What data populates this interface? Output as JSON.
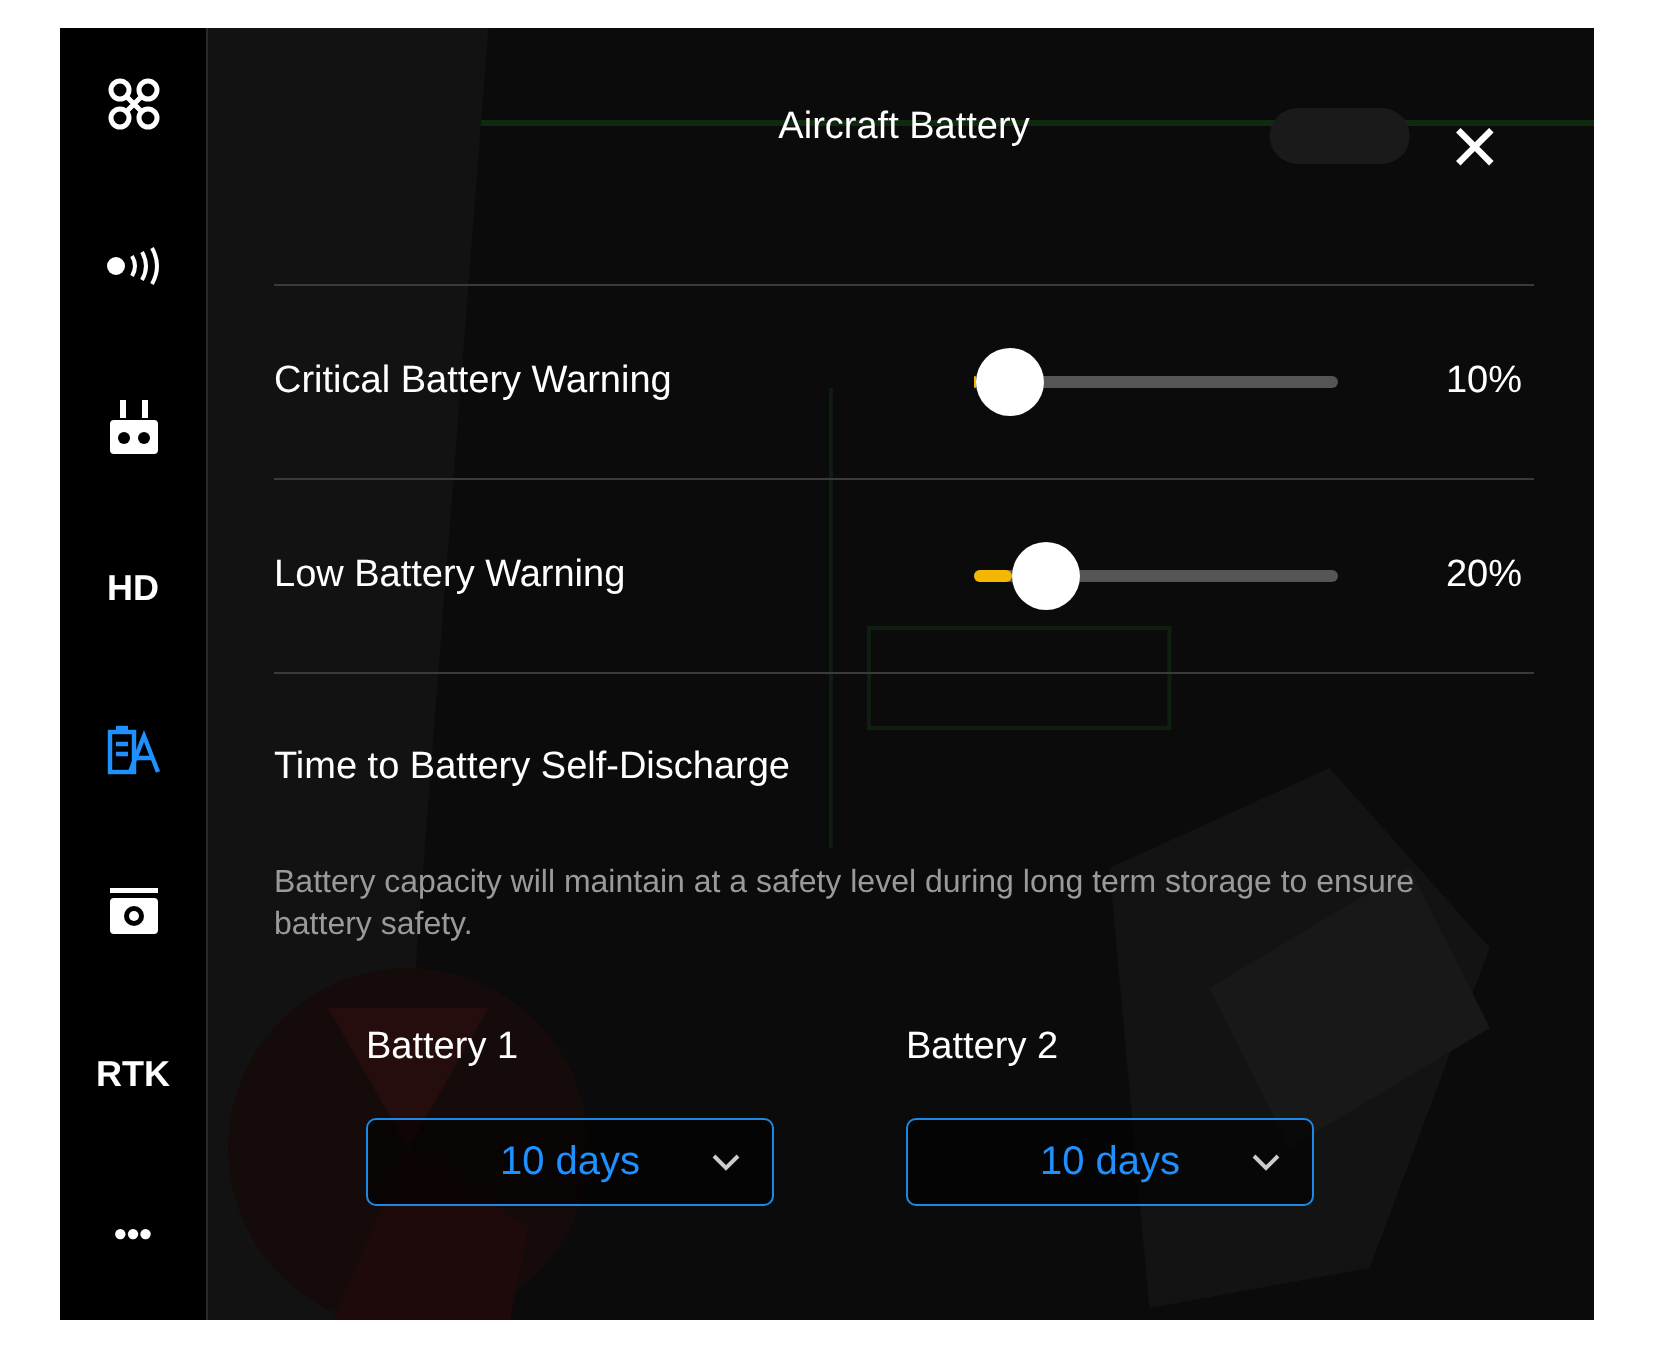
{
  "sidebar": {
    "items": [
      {
        "kind": "aircraft",
        "selected": false
      },
      {
        "kind": "signal",
        "selected": false
      },
      {
        "kind": "controller",
        "selected": false
      },
      {
        "kind": "label",
        "label": "HD",
        "selected": false
      },
      {
        "kind": "battery",
        "selected": true
      },
      {
        "kind": "camera",
        "selected": false
      },
      {
        "kind": "label",
        "label": "RTK",
        "selected": false
      },
      {
        "kind": "label",
        "label": "•••",
        "selected": false
      }
    ]
  },
  "panel": {
    "title": "Aircraft Battery",
    "close": "✕",
    "sliders": [
      {
        "label": "Critical Battery Warning",
        "level": 0.1,
        "reading": "10%"
      },
      {
        "label": "Low Battery Warning",
        "level": 0.2,
        "reading": "20%"
      }
    ],
    "self_discharge": {
      "heading": "Time to Battery Self-Discharge",
      "description": "Battery capacity will maintain at a safety level during long term storage to ensure battery safety.",
      "batteries": [
        {
          "label": "Battery 1",
          "value": "10 days"
        },
        {
          "label": "Battery 2",
          "value": "10 days"
        }
      ]
    }
  }
}
